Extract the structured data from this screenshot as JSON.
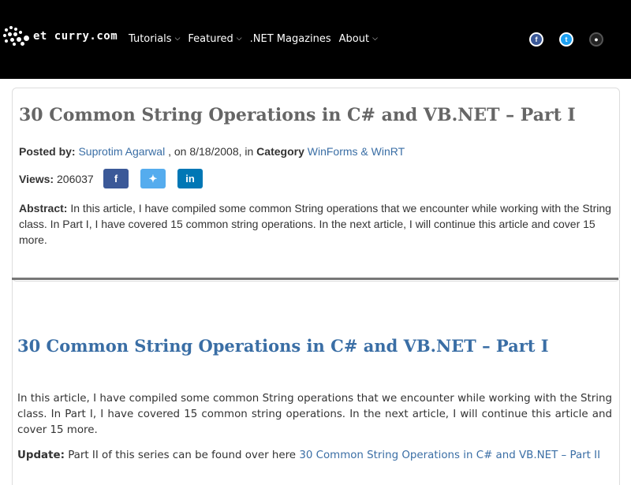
{
  "site": {
    "logo_text": "et curry.com",
    "nav": [
      {
        "label": "Tutorials",
        "has_dropdown": true
      },
      {
        "label": "Featured",
        "has_dropdown": true
      },
      {
        "label": ".NET Magazines",
        "has_dropdown": false
      },
      {
        "label": "About",
        "has_dropdown": true
      }
    ],
    "social": [
      {
        "icon": "facebook-icon",
        "glyph": "f",
        "color": "#3b5998"
      },
      {
        "icon": "twitter-icon",
        "glyph": "t",
        "color": "#1da1f2"
      },
      {
        "icon": "github-icon",
        "glyph": "●",
        "color": "#222222"
      }
    ]
  },
  "article": {
    "title": "30 Common String Operations in C# and VB.NET – Part I",
    "posted_by_label": "Posted by:",
    "author": "Suprotim Agarwal",
    "date_text": ", on 8/18/2008, in",
    "category_label": "Category",
    "category": "WinForms & WinRT",
    "views_label": "Views:",
    "views": "206037",
    "share": [
      {
        "icon": "facebook-icon",
        "glyph": "f",
        "color": "#3b5998"
      },
      {
        "icon": "twitter-icon",
        "glyph": "🐦",
        "color": "#55acee"
      },
      {
        "icon": "linkedin-icon",
        "glyph": "in",
        "color": "#0077b5"
      }
    ],
    "abstract_label": "Abstract:",
    "abstract": "In this article, I have compiled some common String operations that we encounter while working with the String class. In Part I, I have covered 15 common string operations. In the next article, I will continue this article and cover 15 more."
  },
  "content": {
    "heading": "30 Common String Operations in C# and VB.NET – Part I",
    "intro": "In this article, I have compiled some common String operations that we encounter while working with the String class. In Part I, I have covered 15 common string operations. In the next article, I will continue this article and cover 15 more.",
    "update_label": "Update:",
    "update_text": "Part II of this series can be found over here",
    "update_link": "30 Common String Operations in C# and VB.NET – Part II"
  },
  "colors": {
    "topbar": "#000000",
    "link": "#3a6ea5",
    "title_gray": "#666666"
  }
}
